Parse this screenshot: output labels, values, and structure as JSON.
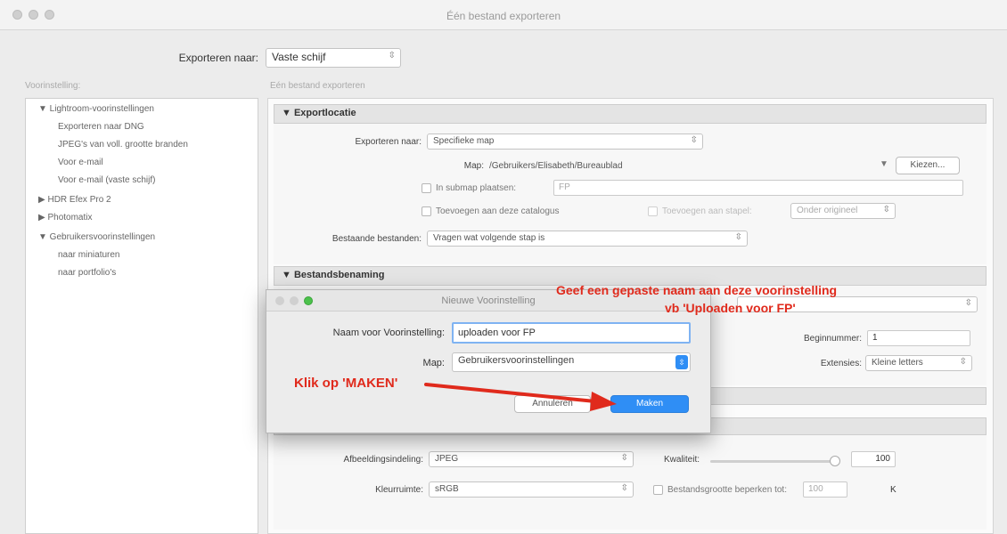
{
  "window": {
    "title": "Één bestand exporteren"
  },
  "top": {
    "export_to_label": "Exporteren naar:",
    "export_to_value": "Vaste schijf"
  },
  "sidebar": {
    "header": "Voorinstelling:",
    "items": [
      {
        "label": "▼ Lightroom-voorinstellingen",
        "indent": 0
      },
      {
        "label": "Exporteren naar DNG",
        "indent": 1
      },
      {
        "label": "JPEG's van voll. grootte branden",
        "indent": 1
      },
      {
        "label": "Voor e-mail",
        "indent": 1
      },
      {
        "label": "Voor e-mail (vaste schijf)",
        "indent": 1
      },
      {
        "label": "▶ HDR Efex Pro 2",
        "indent": 0
      },
      {
        "label": "▶ Photomatix",
        "indent": 0
      },
      {
        "label": "▼ Gebruikersvoorinstellingen",
        "indent": 0
      },
      {
        "label": "naar miniaturen",
        "indent": 1
      },
      {
        "label": "naar portfolio's",
        "indent": 1
      }
    ]
  },
  "main": {
    "header": "Eén bestand exporteren",
    "export_location": {
      "title": "▼ Exportlocatie",
      "export_to_label": "Exporteren naar:",
      "export_to_value": "Specifieke map",
      "folder_label": "Map:",
      "folder_path": "/Gebruikers/Elisabeth/Bureaublad",
      "choose_button": "Kiezen...",
      "subfolder_label": "In submap plaatsen:",
      "subfolder_value": "FP",
      "add_catalog_label": "Toevoegen aan deze catalogus",
      "add_stack_label": "Toevoegen aan stapel:",
      "stack_position": "Onder origineel",
      "existing_label": "Bestaande bestanden:",
      "existing_value": "Vragen wat volgende stap is"
    },
    "file_naming": {
      "title": "▼ Bestandsbenaming",
      "start_number_label": "Beginnummer:",
      "start_number_value": "1",
      "extensions_label": "Extensies:",
      "extensions_value": "Kleine letters"
    },
    "file_settings": {
      "image_format_label": "Afbeeldingsindeling:",
      "image_format_value": "JPEG",
      "quality_label": "Kwaliteit:",
      "quality_value": "100",
      "quality_fraction": 1.0,
      "color_space_label": "Kleurruimte:",
      "color_space_value": "sRGB",
      "limit_size_label": "Bestandsgrootte beperken tot:",
      "limit_size_value": "100",
      "limit_size_unit": "K"
    }
  },
  "dialog": {
    "title": "Nieuwe Voorinstelling",
    "name_label": "Naam voor Voorinstelling:",
    "name_value": "uploaden voor FP",
    "folder_label": "Map:",
    "folder_value": "Gebruikersvoorinstellingen",
    "cancel_button": "Annuleren",
    "create_button": "Maken"
  },
  "annotations": {
    "name_hint_line1": "Geef een gepaste naam aan deze voorinstelling",
    "name_hint_line2": "vb 'Uploaden voor FP'",
    "click_hint": "Klik op 'MAKEN'"
  },
  "colors": {
    "accent": "#2f8ef5",
    "annotation": "#e02a1c"
  },
  "icons": {
    "stepper": "chevron-updown-icon",
    "disclosure": "disclosure-triangle-icon"
  }
}
